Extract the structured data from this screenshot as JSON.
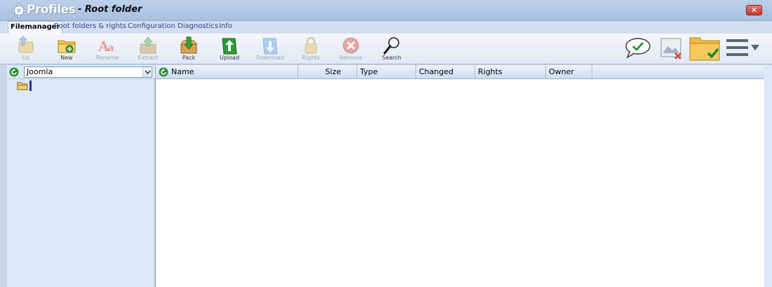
{
  "app": {
    "title": "Root folder",
    "logo_text": "Profiles",
    "close_label": "✕"
  },
  "menu": {
    "tabs": [
      "Filemanager",
      "Root folders & rights",
      "Configuration",
      "Diagnostics",
      "Info"
    ],
    "active_tab": "Filemanager"
  },
  "toolbar": {
    "buttons": [
      {
        "label": "Up",
        "icon": "up-folder-icon",
        "enabled": false
      },
      {
        "label": "New",
        "icon": "new-folder-icon",
        "enabled": true
      },
      {
        "label": "Rename",
        "icon": "rename-icon",
        "enabled": false
      },
      {
        "label": "Extract",
        "icon": "extract-icon",
        "enabled": false
      },
      {
        "label": "Pack",
        "icon": "pack-icon",
        "enabled": true
      },
      {
        "label": "Upload",
        "icon": "upload-icon",
        "enabled": true
      },
      {
        "label": "Download",
        "icon": "download-icon",
        "enabled": false
      },
      {
        "label": "Rights",
        "icon": "lock-icon",
        "enabled": false
      },
      {
        "label": "Remove",
        "icon": "remove-icon",
        "enabled": false
      },
      {
        "label": "Search",
        "icon": "search-icon",
        "enabled": true
      }
    ],
    "right_icons": [
      "speech-check-icon",
      "image-remove-icon",
      "folder-check-icon",
      "menu-icon"
    ]
  },
  "left_pane": {
    "root_select_value": "Joomla"
  },
  "file_list": {
    "columns": [
      "Name",
      "Size",
      "Type",
      "Changed",
      "Rights",
      "Owner"
    ],
    "rows": []
  },
  "colors": {
    "accent": "#27438f",
    "titlebar": "#a8c0df",
    "pane": "#dce8f6",
    "cursor": "#1d2fb6"
  }
}
